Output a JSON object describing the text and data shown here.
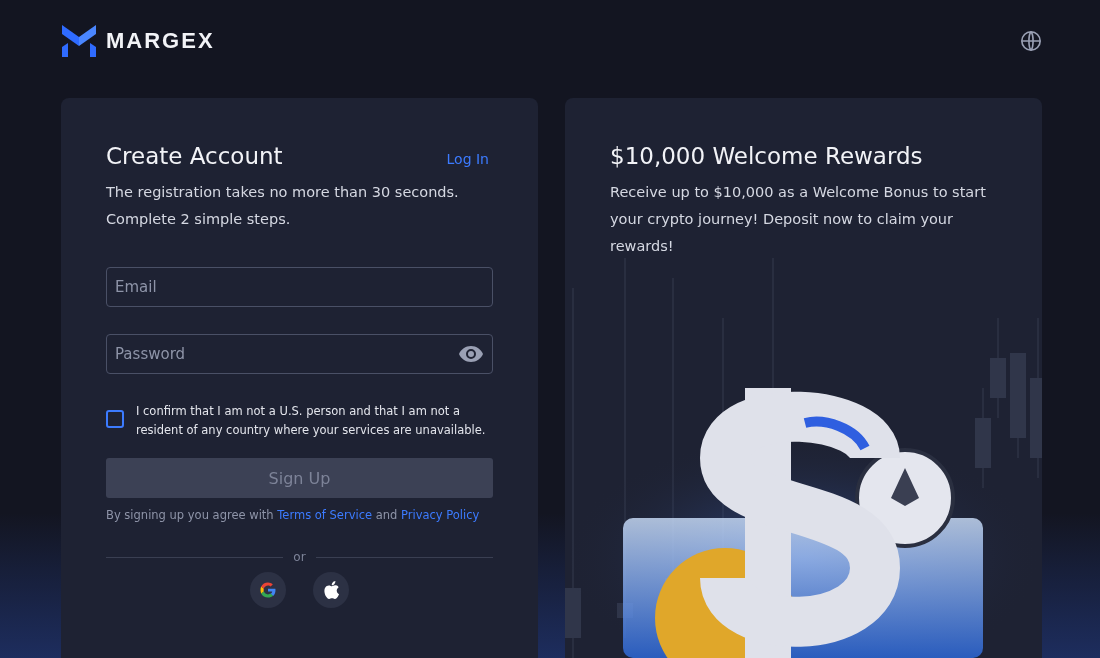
{
  "header": {
    "brand": "MARGEX"
  },
  "signup": {
    "title": "Create Account",
    "login_link": "Log In",
    "intro": [
      "The registration takes no more than 30 seconds.",
      "Complete 2 simple steps."
    ],
    "fields": [
      {
        "kind": "email",
        "placeholder": "Email"
      },
      {
        "kind": "password",
        "placeholder": "Password"
      }
    ],
    "confirm": {
      "checked": false,
      "text": "I confirm that I am not a U.S. person and that I am not a resident of any country where your services are unavailable."
    },
    "submit": {
      "label": "Sign Up",
      "disabled": true
    },
    "terms": {
      "prefix": "By signing up you agree with",
      "terms_link": "Terms of Service",
      "joiner": "and",
      "privacy_link": "Privacy Policy"
    },
    "divider": "or",
    "social": [
      {
        "kind": "google"
      },
      {
        "kind": "apple"
      }
    ]
  },
  "promo": {
    "title": "$10,000 Welcome Rewards",
    "text": "Receive up to $10,000 as a Welcome Bonus to start your crypto journey! Deposit now to claim your rewards!"
  }
}
